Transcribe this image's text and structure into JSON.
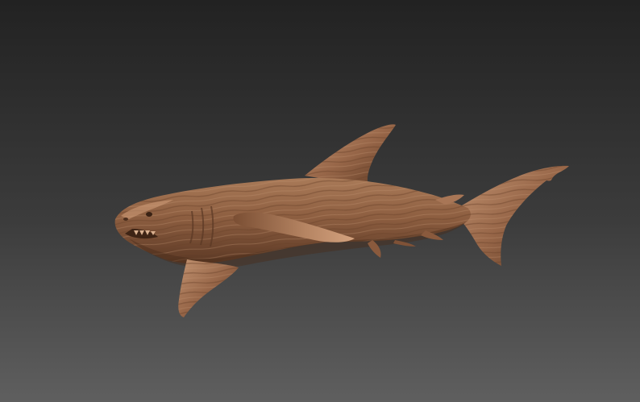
{
  "scene": {
    "subject": "shark-carving",
    "material": "wood",
    "colors": {
      "background_top": "#232323",
      "background_bottom": "#5e5e5e",
      "wood_light": "#b58764",
      "wood_mid": "#936446",
      "wood_dark": "#5f3b25",
      "wood_highlight": "#d3a17c"
    }
  }
}
